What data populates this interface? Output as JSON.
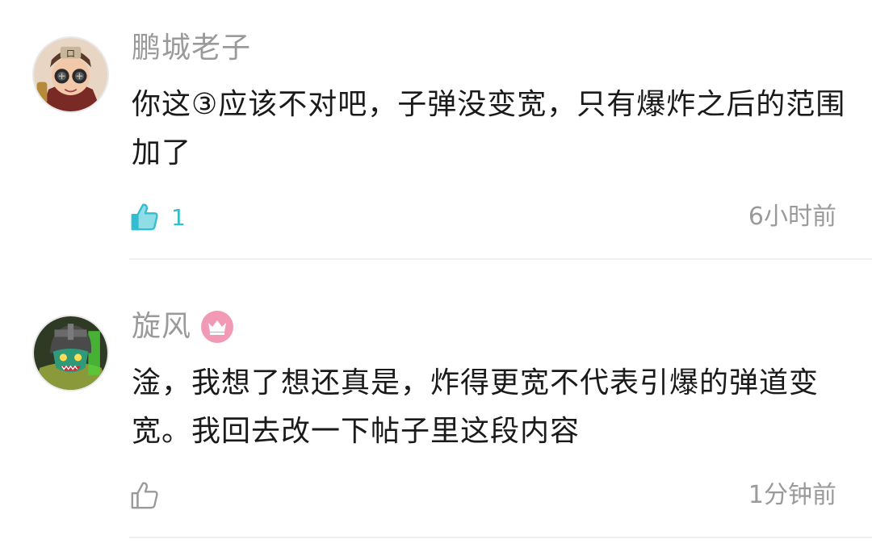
{
  "comments": [
    {
      "username": "鹏城老子",
      "content": "你这③应该不对吧，子弹没变宽，只有爆炸之后的范围加了",
      "like_count": "1",
      "liked": true,
      "time": "6小时前",
      "badge": null,
      "avatar": "avatar-character-with-goggles"
    },
    {
      "username": "旋风",
      "content": "淦，我想了想还真是，炸得更宽不代表引爆的弹道变宽。我回去改一下帖子里这段内容",
      "like_count": "",
      "liked": false,
      "time": "1分钟前",
      "badge": "crown-icon",
      "avatar": "avatar-green-creature-helmet"
    }
  ],
  "colors": {
    "username": "#9a9a9a",
    "content": "#1a1a1a",
    "liked_accent": "#33bdd0",
    "unliked_icon": "#9a9a9a",
    "badge_bg": "#f29ab5",
    "divider": "#efefef"
  }
}
